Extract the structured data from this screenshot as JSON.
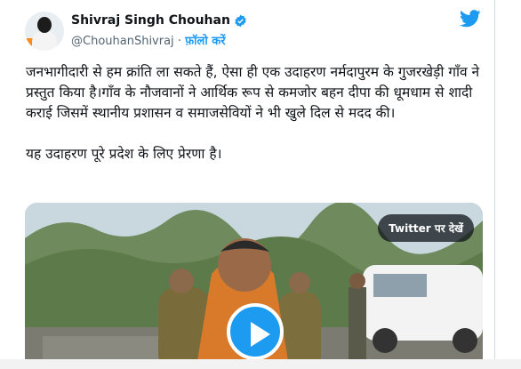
{
  "author": {
    "name": "Shivraj Singh Chouhan",
    "handle": "@ChouhanShivraj",
    "separator": "·",
    "follow_label": "फ़ॉलो करें"
  },
  "icons": {
    "verified": "verified-badge-icon",
    "bird": "twitter-bird-icon",
    "play": "play-icon"
  },
  "colors": {
    "accent": "#1d9bf0",
    "text": "#0f1419",
    "muted": "#536471"
  },
  "tweet": {
    "text": "जनभागीदारी से हम क्रांति ला सकते हैं, ऐसा ही एक उदाहरण नर्मदापुरम के गुजरखेड़ी गाँव ने प्रस्तुत किया है।गाँव के नौजवानों ने आर्थिक रूप से कमजोर बहन दीपा की धूमधाम से शादी कराई जिसमें स्थानीय प्रशासन व समाजसेवियों ने भी खुले दिल से मदद की।\n\nयह उदाहरण पूरे प्रदेश के लिए प्रेरणा है।"
  },
  "media": {
    "view_on_twitter_label": "Twitter पर देखें"
  }
}
